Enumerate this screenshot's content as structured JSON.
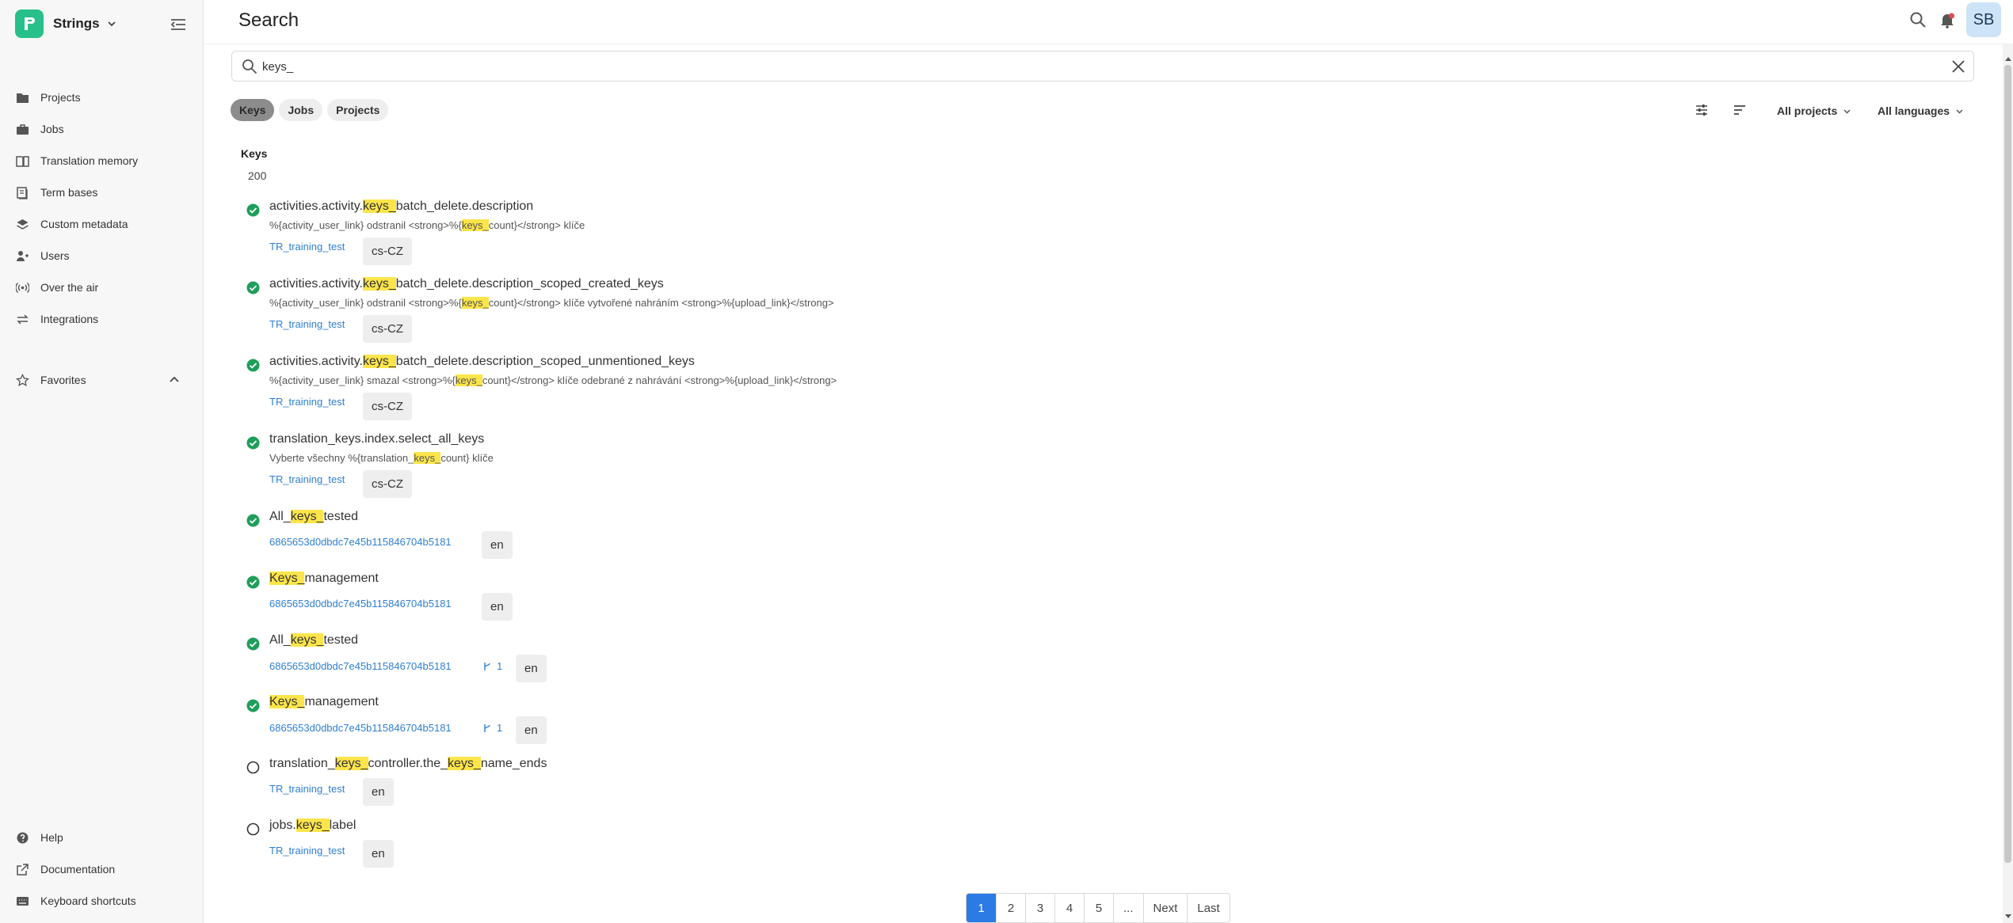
{
  "app": {
    "name": "Strings"
  },
  "sidebar": {
    "items": [
      {
        "label": "Projects",
        "icon": "folder-icon"
      },
      {
        "label": "Jobs",
        "icon": "briefcase-icon"
      },
      {
        "label": "Translation memory",
        "icon": "book-icon"
      },
      {
        "label": "Term bases",
        "icon": "dictionary-icon"
      },
      {
        "label": "Custom metadata",
        "icon": "layers-icon"
      },
      {
        "label": "Users",
        "icon": "users-icon"
      },
      {
        "label": "Over the air",
        "icon": "broadcast-icon"
      },
      {
        "label": "Integrations",
        "icon": "arrows-icon"
      }
    ],
    "favorites_label": "Favorites",
    "bottom_items": [
      {
        "label": "Help",
        "icon": "help-icon"
      },
      {
        "label": "Documentation",
        "icon": "external-link-icon"
      },
      {
        "label": "Keyboard shortcuts",
        "icon": "keyboard-icon"
      }
    ]
  },
  "header": {
    "title": "Search",
    "avatar_initials": "SB"
  },
  "search": {
    "value": "keys_"
  },
  "tabs": [
    {
      "label": "Keys",
      "active": true
    },
    {
      "label": "Jobs",
      "active": false
    },
    {
      "label": "Projects",
      "active": false
    }
  ],
  "filters": {
    "projects": "All projects",
    "languages": "All languages"
  },
  "results": {
    "heading": "Keys",
    "count": "200",
    "items": [
      {
        "status": "done",
        "key": {
          "pre": "activities.activity.",
          "hl": "keys_",
          "post": "batch_delete.description"
        },
        "desc": {
          "pre": "%{activity_user_link} odstranil <strong>%{",
          "hl": "keys_",
          "post": "count}</strong> klíče"
        },
        "project": "TR_training_test",
        "branch": "",
        "lang": "cs-CZ"
      },
      {
        "status": "done",
        "key": {
          "pre": "activities.activity.",
          "hl": "keys_",
          "post": "batch_delete.description_scoped_created_keys"
        },
        "desc": {
          "pre": "%{activity_user_link} odstranil <strong>%{",
          "hl": "keys_",
          "post": "count}</strong> klíče vytvořené nahráním <strong>%{upload_link}</strong>"
        },
        "project": "TR_training_test",
        "branch": "",
        "lang": "cs-CZ"
      },
      {
        "status": "done",
        "key": {
          "pre": "activities.activity.",
          "hl": "keys_",
          "post": "batch_delete.description_scoped_unmentioned_keys"
        },
        "desc": {
          "pre": "%{activity_user_link} smazal <strong>%{",
          "hl": "keys_",
          "post": "count}</strong> klíče odebrané z nahrávání <strong>%{upload_link}</strong>"
        },
        "project": "TR_training_test",
        "branch": "",
        "lang": "cs-CZ"
      },
      {
        "status": "done",
        "key": {
          "pre": "translation_keys.index.select_all_keys",
          "hl": "",
          "post": ""
        },
        "desc": {
          "pre": "Vyberte všechny %{translation_",
          "hl": "keys_",
          "post": "count} klíče"
        },
        "project": "TR_training_test",
        "branch": "",
        "lang": "cs-CZ"
      },
      {
        "status": "done",
        "key": {
          "pre": "All_",
          "hl": "keys_",
          "post": "tested"
        },
        "desc": null,
        "project": "6865653d0dbdc7e45b115846704b5181",
        "branch": "",
        "lang": "en"
      },
      {
        "status": "done",
        "key": {
          "pre": "",
          "hl": "Keys_",
          "post": "management"
        },
        "desc": null,
        "project": "6865653d0dbdc7e45b115846704b5181",
        "branch": "",
        "lang": "en"
      },
      {
        "status": "done",
        "key": {
          "pre": "All_",
          "hl": "keys_",
          "post": "tested"
        },
        "desc": null,
        "project": "6865653d0dbdc7e45b115846704b5181",
        "branch": "1",
        "lang": "en"
      },
      {
        "status": "done",
        "key": {
          "pre": "",
          "hl": "Keys_",
          "post": "management"
        },
        "desc": null,
        "project": "6865653d0dbdc7e45b115846704b5181",
        "branch": "1",
        "lang": "en"
      },
      {
        "status": "pending",
        "key": {
          "pre": "translation_",
          "hl": "keys_",
          "mid": "controller.the_",
          "hl2": "keys_",
          "post": "name_ends"
        },
        "desc": null,
        "project": "TR_training_test",
        "branch": "",
        "lang": "en"
      },
      {
        "status": "pending",
        "key": {
          "pre": "jobs.",
          "hl": "keys_",
          "post": "label"
        },
        "desc": null,
        "project": "TR_training_test",
        "branch": "",
        "lang": "en"
      }
    ]
  },
  "pagination": {
    "pages": [
      "1",
      "2",
      "3",
      "4",
      "5",
      "..."
    ],
    "next": "Next",
    "last": "Last",
    "current": "1"
  },
  "colors": {
    "accent": "#2c7be5",
    "success": "#1e9e5a",
    "highlight": "#fce54a",
    "brand": "#27c08a"
  }
}
